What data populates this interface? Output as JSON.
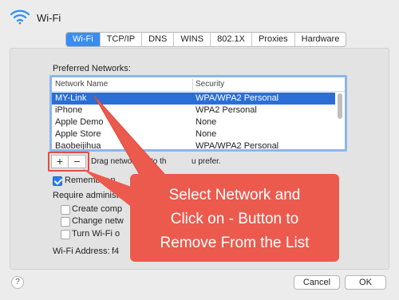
{
  "window": {
    "title": "Wi-Fi"
  },
  "tabs": [
    "Wi-Fi",
    "TCP/IP",
    "DNS",
    "WINS",
    "802.1X",
    "Proxies",
    "Hardware"
  ],
  "preferred": {
    "label": "Preferred Networks:",
    "columns": {
      "name": "Network Name",
      "security": "Security"
    },
    "rows": [
      {
        "name": "MY-Link",
        "security": "WPA/WPA2 Personal",
        "selected": true
      },
      {
        "name": "iPhone",
        "security": "WPA2 Personal"
      },
      {
        "name": "Apple Demo",
        "security": "None"
      },
      {
        "name": "Apple Store",
        "security": "None"
      },
      {
        "name": "Baobeijihua",
        "security": "WPA/WPA2 Personal"
      }
    ]
  },
  "controls": {
    "add_symbol": "+",
    "remove_symbol": "−",
    "drag_hint": "Drag networks into th",
    "drag_hint_tail": "u prefer."
  },
  "options": {
    "remember": {
      "label": "Remember n",
      "checked": true
    },
    "require_admin": "Require administ",
    "create_comp": {
      "label": "Create comp",
      "checked": false
    },
    "change_net": {
      "label": "Change netw",
      "checked": false
    },
    "turn_wifi": {
      "label": "Turn Wi-Fi o",
      "checked": false
    }
  },
  "address": {
    "label": "Wi-Fi Address:",
    "value": "f4"
  },
  "footer": {
    "help": "?",
    "cancel": "Cancel",
    "ok": "OK"
  },
  "callout": {
    "lines": [
      "Select Network and",
      "Click on - Button to",
      "Remove From the List"
    ],
    "color": "#ec5a4d"
  },
  "colors": {
    "selection": "#2b6fd6",
    "tab_active": "#3b8cf1",
    "focus_ring": "#8bb6ee"
  },
  "icons": {
    "wifi": "wifi-icon",
    "help": "question-icon"
  }
}
